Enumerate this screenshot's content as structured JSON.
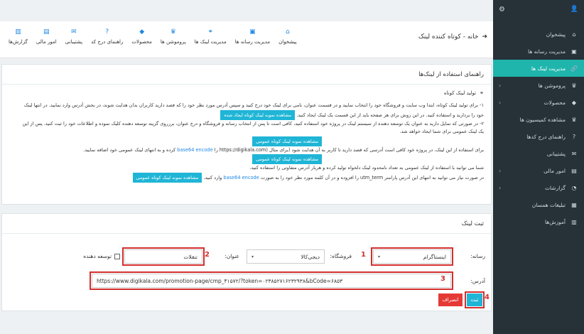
{
  "sidebar": {
    "items": [
      {
        "label": "پیشخوان",
        "icon": "home-icon",
        "glyph": "⌂",
        "chev": ""
      },
      {
        "label": "مدیریت رسانه ها",
        "icon": "media-icon",
        "glyph": "▣",
        "chev": ""
      },
      {
        "label": "مدیریت لینک ها",
        "icon": "link-icon",
        "glyph": "🔗",
        "chev": "",
        "active": true
      },
      {
        "label": "پروموشن ها",
        "icon": "trophy-icon",
        "glyph": "♛",
        "chev": "‹"
      },
      {
        "label": "محصولات",
        "icon": "tag-icon",
        "glyph": "◆",
        "chev": "‹"
      },
      {
        "label": "مشاهده کمیسیون ها",
        "icon": "trophy-icon",
        "glyph": "♛",
        "chev": ""
      },
      {
        "label": "راهنمای درج کدها",
        "icon": "help-icon",
        "glyph": "?",
        "chev": ""
      },
      {
        "label": "پشتیبانی",
        "icon": "chat-icon",
        "glyph": "✉",
        "chev": ""
      },
      {
        "label": "امور مالی",
        "icon": "wallet-icon",
        "glyph": "▤",
        "chev": "‹"
      },
      {
        "label": "گزارشات",
        "icon": "report-icon",
        "glyph": "◔",
        "chev": "‹"
      },
      {
        "label": "تبلیغات همسان",
        "icon": "ads-icon",
        "glyph": "▦",
        "chev": ""
      },
      {
        "label": "آموزش‌ها",
        "icon": "book-icon",
        "glyph": "▥",
        "chev": ""
      }
    ]
  },
  "header": {
    "breadcrumb": "خانه - کوتاه کننده لینک"
  },
  "nav": [
    {
      "label": "گزارش‌ها",
      "icon": "report-icon",
      "glyph": "▥"
    },
    {
      "label": "امور مالی",
      "icon": "wallet-icon",
      "glyph": "▤"
    },
    {
      "label": "پشتیبانی",
      "icon": "chat-icon",
      "glyph": "✉"
    },
    {
      "label": "راهنمای درج کد",
      "icon": "help-icon",
      "glyph": "?"
    },
    {
      "label": "محصولات",
      "icon": "tag-icon",
      "glyph": "◆"
    },
    {
      "label": "پروموشن ها",
      "icon": "trophy-icon",
      "glyph": "♛"
    },
    {
      "label": "مدیریت لینک ها",
      "icon": "link-icon",
      "glyph": "⚭"
    },
    {
      "label": "مدیریت رسانه ها",
      "icon": "media-icon",
      "glyph": "▣"
    },
    {
      "label": "پیشخوان",
      "icon": "home-icon",
      "glyph": "⌂"
    }
  ],
  "guide": {
    "title": "راهنمای استفاده از لینک‌ها",
    "subtitle": "تولید لینک کوتاه",
    "p1a": "۱- برای تولید لینک کوتاه، ابتدا وب سایت و فروشگاه خود را انتخاب نمایید و در قسمت عنوان، نامی برای لینک خود درج کنید و سپس آدرس مورد نظر خود را که قصد دارید کاربران بدان هدایت شوند، در بخش آدرس وارد نمایید. در انتها لینک",
    "p1b": "خود را بردارید و استفاده کنید. در این روش برای هر صفحه باید از این قسمت یک لینک ایجاد کنید.",
    "btn1": "مشاهده نمونه لینک کوتاه ایجاد شده",
    "p2a": "۲- در صورتی که تمایل دارید به عنوان یک توسعه دهنده از سیستم لینک در پروژه خود استفاده کنید، کافی است تا پس از انتخاب رسانه و فروشگاه و درج عنوان، بررروی گزینه توسعه دهنده کلیک نموده و اطلاعات خود را ثبت کنید. پس از این",
    "p2b": "یک لینک عمومی برای شما ایجاد خواهد شد.",
    "btn2": "مشاهده نمونه لینک کوتاه عمومی",
    "p3a": "برای استفاده از این لینک، در پروژه خود کافی است آدرسی که قصد دارید تا کاربر به آن هدایت شود (برای مثال (https://digikala.com را",
    "p3link": "base64 encode",
    "p3b": "کرده و به انتهای لینک عمومی خود اضافه نمایید.",
    "btn3": "مشاهده نمونه لینک کوتاه عمومی",
    "p4": "شما می توانید با استفاده از لینک عمومی به تعداد نامحدود لینک دلخواه تولید کرده و هربار آدرس متفاوتی را استفاده کنید.",
    "p5a": "در صورت نیاز می توانید به انتهای این آدرس پارامتر utm_term را افزوده و در آن کلمه مورد نظر خود را به صورت",
    "p5link": "base64 encode",
    "p5b": "وارد کنید.",
    "btn4": "مشاهده نمونه لینک کوتاه عمومی"
  },
  "form": {
    "title": "ثبت لینک",
    "media_label": "رسانه:",
    "media_value": "اینستاگرام",
    "store_label": "فروشگاه:",
    "store_value": "دیجی‌کالا",
    "title_label": "عنوان:",
    "title_value": "تنقلات",
    "developer_label": "توسعه دهنده",
    "address_label": "آدرس:",
    "address_value": "https://www.digikala.com/promotion-page/cmp_۴۱۵۷۲/?token=۰۲۳۸۵۲۷۱۶۲۳۲۹۳۸&bCode=۶۸۵۳",
    "submit_label": "ثبت",
    "cancel_label": "انصراف"
  },
  "annotations": [
    "1",
    "2",
    "3",
    "4"
  ],
  "colors": {
    "accent": "#1fb5ac",
    "sidebar_bg": "#263238",
    "button": "#1fb5d6",
    "danger": "#e53935",
    "annotation": "#d32f2f"
  }
}
